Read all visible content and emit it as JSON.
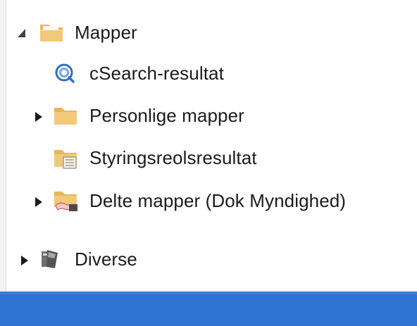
{
  "tree": {
    "mapper": {
      "label": "Mapper",
      "expanded": true
    },
    "csearch": {
      "label": "cSearch-resultat"
    },
    "personlige": {
      "label": "Personlige mapper",
      "expanded": false
    },
    "styring": {
      "label": "Styringsreolsresultat"
    },
    "delte": {
      "label": "Delte mapper (Dok Myndighed)",
      "expanded": false
    },
    "diverse": {
      "label": "Diverse",
      "expanded": false
    }
  },
  "colors": {
    "folder": "#f2c97a",
    "status_bar": "#2d74d2",
    "search_icon": "#2f6fc0"
  },
  "icons": {
    "mapper": "folder-open-icon",
    "csearch": "search-result-icon",
    "personlige": "folder-icon",
    "styring": "shelf-folder-icon",
    "delte": "shared-folder-icon",
    "diverse": "misc-icon"
  }
}
